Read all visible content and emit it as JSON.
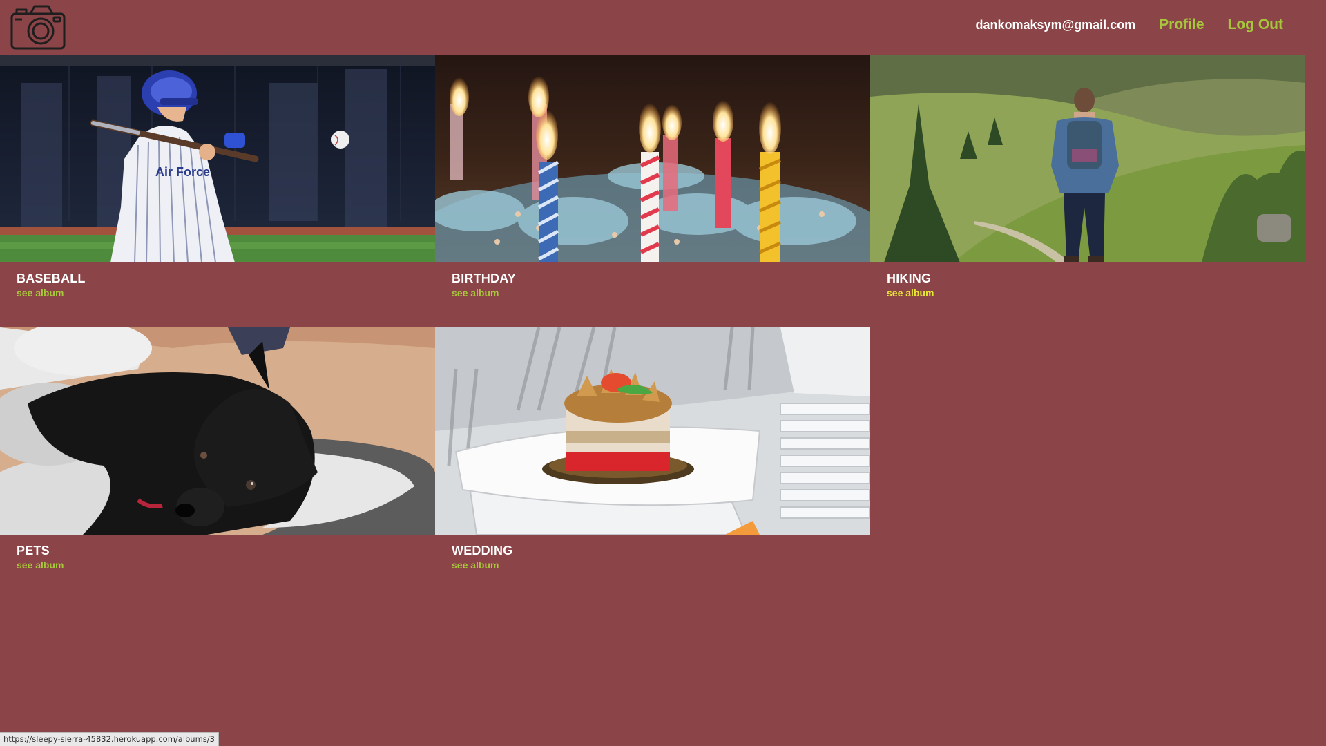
{
  "header": {
    "logo_icon": "camera-icon",
    "user_email": "dankomaksym@gmail.com",
    "profile_label": "Profile",
    "logout_label": "Log Out"
  },
  "albums": [
    {
      "title": "BASEBALL",
      "link_label": "see album",
      "image": "baseball-player-photo"
    },
    {
      "title": "BIRTHDAY",
      "link_label": "see album",
      "image": "birthday-candles-photo"
    },
    {
      "title": "HIKING",
      "link_label": "see album",
      "image": "hiker-mountain-photo"
    },
    {
      "title": "PETS",
      "link_label": "see album",
      "image": "black-puppy-photo"
    },
    {
      "title": "WEDDING",
      "link_label": "see album",
      "image": "wedding-cake-photo"
    }
  ],
  "status_bar": {
    "url": "https://sleepy-sierra-45832.herokuapp.com/albums/3"
  },
  "colors": {
    "background": "#8b4447",
    "accent": "#a8c63c",
    "link_hover": "#e8e635",
    "text": "#ffffff"
  }
}
